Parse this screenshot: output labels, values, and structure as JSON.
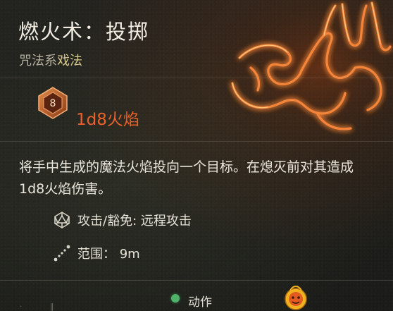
{
  "spell": {
    "title": "燃火术：投掷",
    "school": "咒法系",
    "kind": "戏法",
    "damage_die": "8",
    "damage_text": "1d8火焰",
    "description": "将手中生成的魔法火焰投向一个目标。在熄灭前对其造成1d8火焰伤害。",
    "attack_label": "攻击/豁免: 远程攻击",
    "range_label": "范围：  9m"
  },
  "footer": {
    "action_label": "动作"
  },
  "colors": {
    "fire_orange": "#e8622a",
    "gold": "#d8c98a",
    "action_green": "#4fb36a"
  },
  "icons": [
    "fire-hand-icon",
    "d8-die-icon",
    "attack-save-icon",
    "range-icon",
    "action-dot-icon",
    "site-logo"
  ]
}
